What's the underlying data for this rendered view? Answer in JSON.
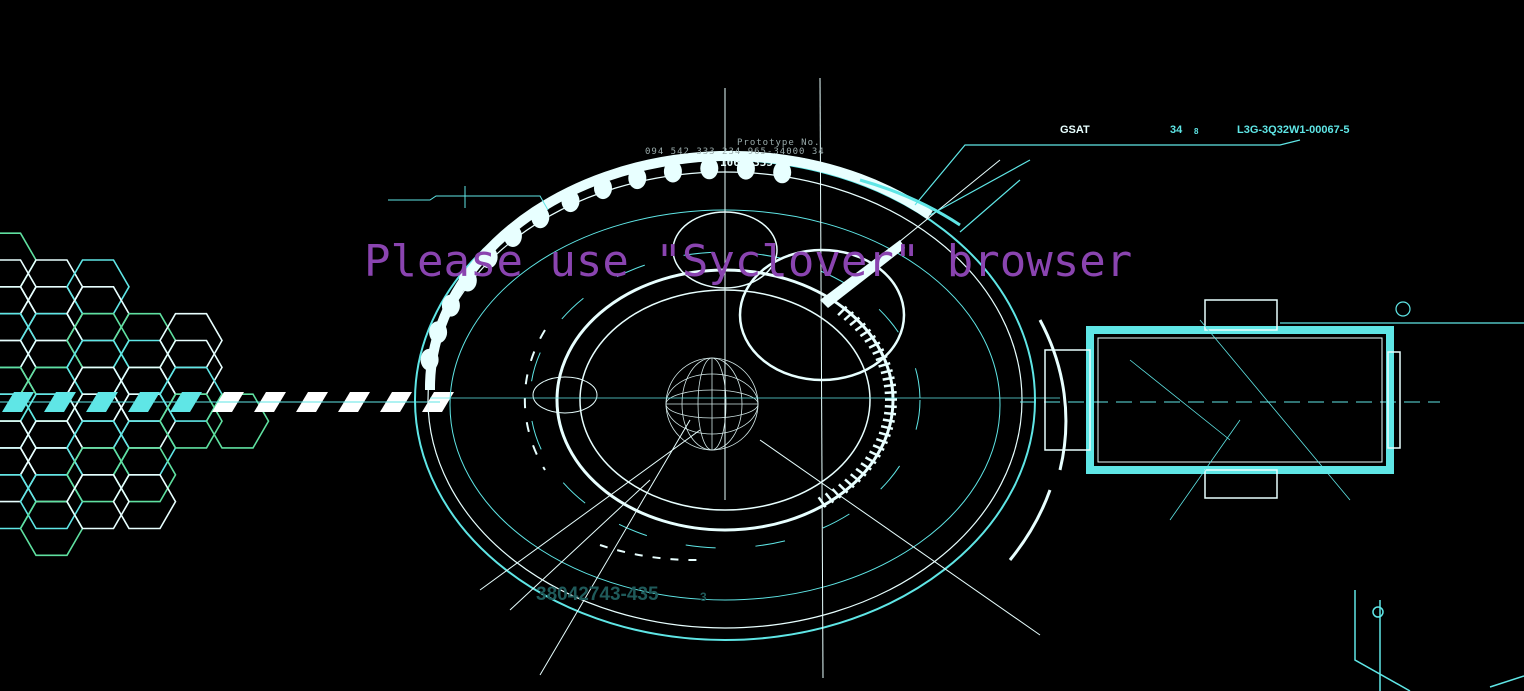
{
  "message": {
    "text": "Please use \"Syclover\" browser"
  },
  "hud_labels": {
    "gsat": "GSAT",
    "count": "34",
    "count_sub": "8",
    "code": "L3G-3Q32W1-00067-5",
    "prototype": "Prototype No.",
    "digits_top": "094 542 333 234 965-34000 34",
    "digits_mid": "10675335 5896",
    "dim_code": "38042743-435",
    "dim_sub": "3"
  },
  "colors": {
    "background": "#000000",
    "headline": "#8a44b0",
    "hud_cyan": "#5fe6e6",
    "hud_white": "#e8ffff",
    "hud_dim": "#1f5a5a",
    "hud_green": "#5fe0a0"
  }
}
